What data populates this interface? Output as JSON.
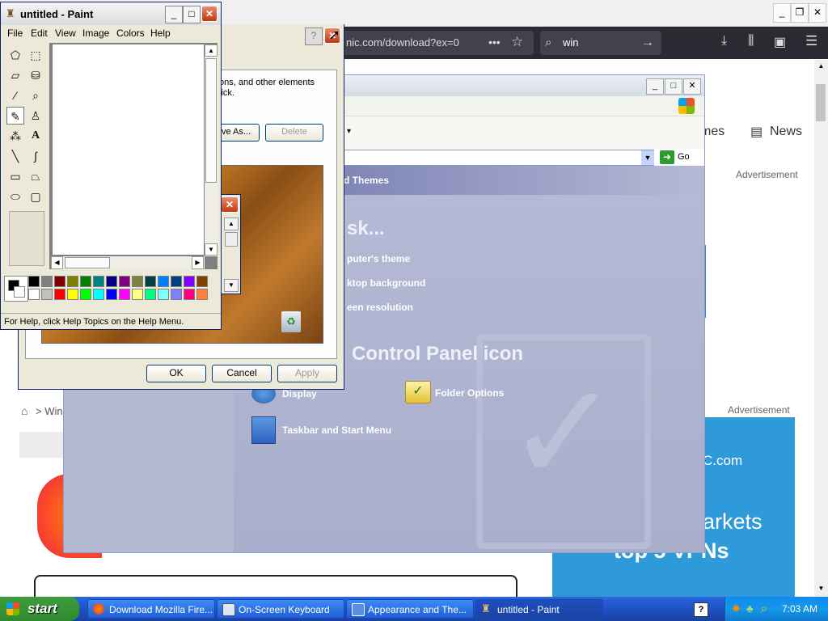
{
  "browser": {
    "url_fragment": "nic.com/download?ex=0",
    "search_value": "win",
    "nav_items": [
      "mes",
      "News"
    ],
    "ad_label_1": "Advertisement",
    "ad_label_2": "Advertisement",
    "breadcrumb": "Win",
    "ad_text_1": "C.com",
    "ad_text_2": "arkets",
    "ad_text_3": "top 5 VPNs"
  },
  "control_panel": {
    "title_fragment": "d Themes",
    "go_label": "Go",
    "pick_task": "sk...",
    "tasks": [
      "puter's theme",
      "ktop background",
      "een resolution"
    ],
    "pick_icon": "Control Panel icon",
    "icons": [
      "Display",
      "Folder Options",
      "Taskbar and Start Menu"
    ]
  },
  "display_props": {
    "desc_line1": "ons, and other elements",
    "desc_line2": "lick.",
    "save_as": "ve As...",
    "delete": "Delete",
    "ok": "OK",
    "cancel": "Cancel",
    "apply": "Apply"
  },
  "paint": {
    "title": "untitled - Paint",
    "menu": [
      "File",
      "Edit",
      "View",
      "Image",
      "Colors",
      "Help"
    ],
    "status": "For Help, click Help Topics on the Help Menu.",
    "palette_row1": [
      "#000000",
      "#808080",
      "#800000",
      "#808000",
      "#008000",
      "#008080",
      "#000080",
      "#800080",
      "#808040",
      "#004040",
      "#0080ff",
      "#004080",
      "#8000ff",
      "#804000"
    ],
    "palette_row2": [
      "#ffffff",
      "#c0c0c0",
      "#ff0000",
      "#ffff00",
      "#00ff00",
      "#00ffff",
      "#0000ff",
      "#ff00ff",
      "#ffff80",
      "#00ff80",
      "#80ffff",
      "#8080ff",
      "#ff0080",
      "#ff8040"
    ]
  },
  "taskbar": {
    "start": "start",
    "tasks": [
      "Download Mozilla Fire...",
      "On-Screen Keyboard",
      "Appearance and The...",
      "untitled - Paint"
    ],
    "clock": "7:03 AM"
  }
}
